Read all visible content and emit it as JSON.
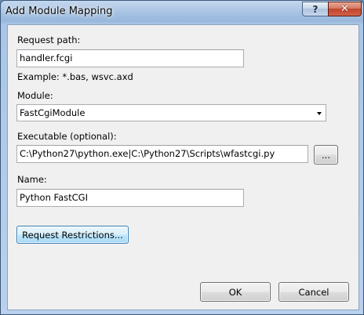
{
  "window": {
    "title": "Add Module Mapping",
    "help_glyph": "?",
    "close_glyph": "✕"
  },
  "form": {
    "request_path": {
      "label": "Request path:",
      "value": "handler.fcgi",
      "example": "Example: *.bas, wsvc.axd"
    },
    "module": {
      "label": "Module:",
      "selected": "FastCgiModule"
    },
    "executable": {
      "label": "Executable (optional):",
      "value": "C:\\Python27\\python.exe|C:\\Python27\\Scripts\\wfastcgi.py",
      "browse_label": "..."
    },
    "name": {
      "label": "Name:",
      "value": "Python FastCGI"
    },
    "request_restrictions_label": "Request Restrictions..."
  },
  "footer": {
    "ok_label": "OK",
    "cancel_label": "Cancel"
  }
}
